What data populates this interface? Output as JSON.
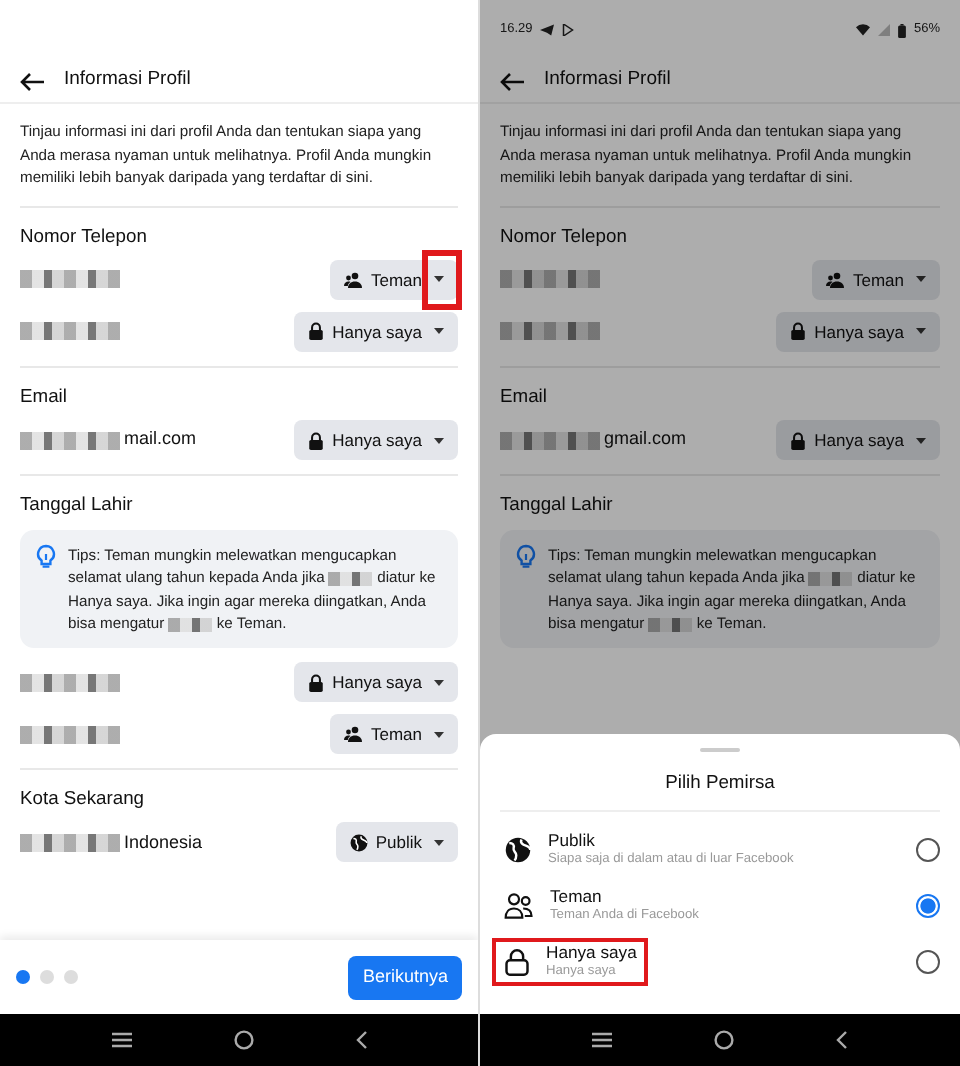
{
  "screens": [
    {
      "header": {
        "title": "Informasi Profil"
      },
      "intro": "Tinjau informasi ini dari profil Anda dan tentukan siapa yang Anda merasa nyaman untuk melihatnya. Profil Anda mungkin memiliki lebih banyak daripada yang terdaftar di sini.",
      "sections": [
        {
          "title": "Nomor Telepon",
          "rows": [
            {
              "value": [
                {
                  "kind": "redacted"
                }
              ],
              "audience": {
                "kind": "friends",
                "label": "Teman",
                "highlighted": true
              }
            },
            {
              "value": [
                {
                  "kind": "redacted"
                }
              ],
              "audience": {
                "kind": "lock",
                "label": "Hanya saya",
                "highlighted": false
              }
            }
          ]
        },
        {
          "title": "Email",
          "rows": [
            {
              "value": [
                {
                  "kind": "redacted"
                },
                {
                  "kind": "text",
                  "text": "mail.com"
                }
              ],
              "audience": {
                "kind": "lock",
                "label": "Hanya saya",
                "highlighted": false
              }
            }
          ]
        },
        {
          "title": "Tanggal Lahir",
          "tips": [
            {
              "kind": "text",
              "text": "Tips: Teman mungkin melewatkan mengucapkan selamat ulang tahun kepada Anda jika"
            },
            {
              "kind": "redacted"
            },
            {
              "kind": "text",
              "text": "diatur ke Hanya saya. Jika ingin agar mereka diingatkan, Anda bisa mengatur"
            },
            {
              "kind": "redacted"
            },
            {
              "kind": "text",
              "text": "ke Teman."
            }
          ],
          "rows": [
            {
              "value": [
                {
                  "kind": "redacted"
                }
              ],
              "audience": {
                "kind": "lock",
                "label": "Hanya saya",
                "highlighted": false
              }
            },
            {
              "value": [
                {
                  "kind": "redacted"
                }
              ],
              "audience": {
                "kind": "friends",
                "label": "Teman",
                "highlighted": false
              }
            }
          ]
        },
        {
          "title": "Kota Sekarang",
          "rows": [
            {
              "value": [
                {
                  "kind": "redacted"
                },
                {
                  "kind": "text",
                  "text": "Indonesia"
                }
              ],
              "audience": {
                "kind": "globe",
                "label": "Publik",
                "highlighted": false
              }
            }
          ]
        }
      ],
      "footer": {
        "dots": [
          {
            "selected": true
          },
          {
            "selected": false
          },
          {
            "selected": false
          }
        ],
        "button": "Berikutnya"
      }
    },
    {
      "status_bar": {
        "time": "16.29",
        "battery": "56%"
      },
      "header": {
        "title": "Informasi Profil"
      },
      "intro": "Tinjau informasi ini dari profil Anda dan tentukan siapa yang Anda merasa nyaman untuk melihatnya. Profil Anda mungkin memiliki lebih banyak daripada yang terdaftar di sini.",
      "sections": [
        {
          "title": "Nomor Telepon",
          "rows": [
            {
              "value": [
                {
                  "kind": "redacted"
                }
              ],
              "audience": {
                "kind": "friends",
                "label": "Teman",
                "highlighted": false
              }
            },
            {
              "value": [
                {
                  "kind": "redacted"
                }
              ],
              "audience": {
                "kind": "lock",
                "label": "Hanya saya",
                "highlighted": false
              }
            }
          ]
        },
        {
          "title": "Email",
          "rows": [
            {
              "value": [
                {
                  "kind": "redacted"
                },
                {
                  "kind": "text",
                  "text": "gmail.com"
                }
              ],
              "audience": {
                "kind": "lock",
                "label": "Hanya saya",
                "highlighted": false
              }
            }
          ]
        },
        {
          "title": "Tanggal Lahir",
          "tips": [
            {
              "kind": "text",
              "text": "Tips: Teman mungkin melewatkan mengucapkan selamat ulang tahun kepada Anda jika"
            },
            {
              "kind": "redacted"
            },
            {
              "kind": "text",
              "text": "diatur ke Hanya saya. Jika ingin agar mereka diingatkan, Anda bisa mengatur"
            },
            {
              "kind": "redacted"
            },
            {
              "kind": "text",
              "text": "ke Teman."
            }
          ]
        }
      ],
      "sheet": {
        "title": "Pilih Pemirsa",
        "options": [
          {
            "kind": "globe",
            "label": "Publik",
            "description": "Siapa saja di dalam atau di luar Facebook",
            "selected": false,
            "highlighted": false
          },
          {
            "kind": "friends",
            "label": "Teman",
            "description": "Teman Anda di Facebook",
            "selected": true,
            "highlighted": false
          },
          {
            "kind": "lock",
            "label": "Hanya saya",
            "description": "Hanya saya",
            "selected": false,
            "highlighted": true
          }
        ]
      }
    }
  ]
}
